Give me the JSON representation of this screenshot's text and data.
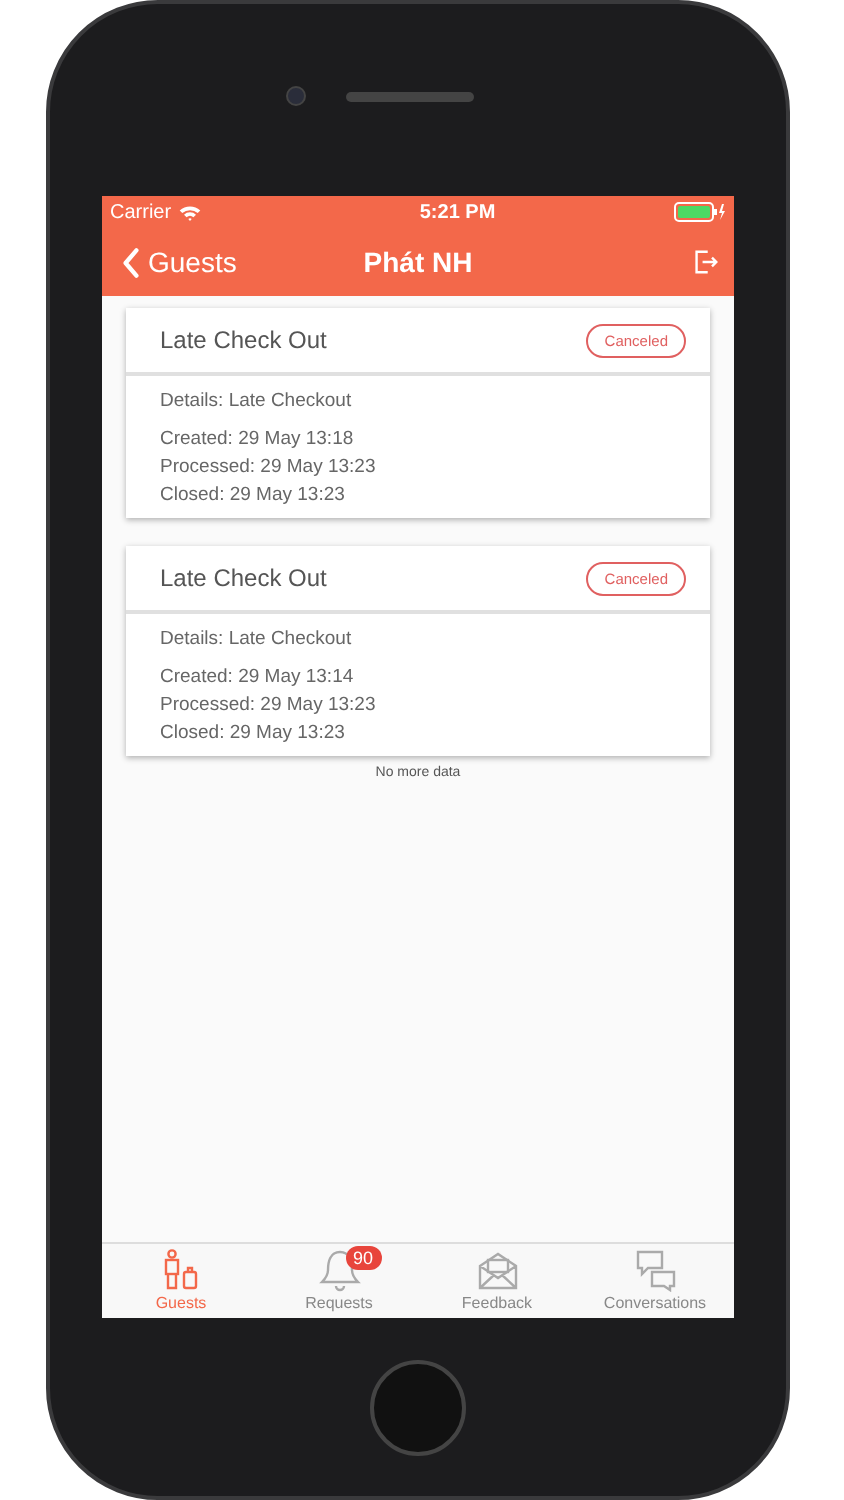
{
  "status_bar": {
    "carrier": "Carrier",
    "time": "5:21 PM"
  },
  "nav_bar": {
    "back": "Guests",
    "title": "Phát NH"
  },
  "requests": [
    {
      "title": "Late Check Out",
      "status": "Canceled",
      "details": "Details: Late Checkout",
      "created": "Created: 29 May 13:18",
      "processed": "Processed: 29 May 13:23",
      "closed": "Closed: 29 May 13:23"
    },
    {
      "title": "Late Check Out",
      "status": "Canceled",
      "details": "Details: Late Checkout",
      "created": "Created: 29 May 13:14",
      "processed": "Processed: 29 May 13:23",
      "closed": "Closed: 29 May 13:23"
    }
  ],
  "list_footer": "No more data",
  "tab_bar": [
    {
      "label": "Guests",
      "selected": true
    },
    {
      "label": "Requests",
      "selected": false,
      "badge": "90"
    },
    {
      "label": "Feedback",
      "selected": false
    },
    {
      "label": "Conversations",
      "selected": false
    }
  ]
}
